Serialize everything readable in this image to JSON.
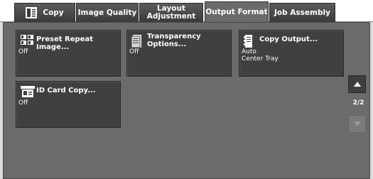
{
  "tabs": [
    {
      "label": "Copy",
      "icon": "copy-icon"
    },
    {
      "label": "Image Quality"
    },
    {
      "label": "Layout\nAdjustment"
    },
    {
      "label": "Output Format",
      "active": true
    },
    {
      "label": "Job Assembly"
    }
  ],
  "buttons": [
    {
      "title": "Preset Repeat Image...",
      "value": "Off",
      "icon": "preset-repeat-image-icon"
    },
    {
      "title": "Transparency\nOptions...",
      "value": "Off",
      "icon": "transparency-options-icon"
    },
    {
      "title": "Copy Output...",
      "value": "Auto\nCenter Tray",
      "icon": "copy-output-icon"
    },
    {
      "title": "ID Card Copy...",
      "value": "Off",
      "icon": "id-card-copy-icon"
    }
  ],
  "pager": {
    "indicator": "2/2",
    "up_icon": "arrow-up-icon",
    "down_icon": "arrow-down-icon"
  },
  "colors": {
    "panel": "#6b6b6b",
    "button": "#404040",
    "tab": "#3a3a3a"
  }
}
